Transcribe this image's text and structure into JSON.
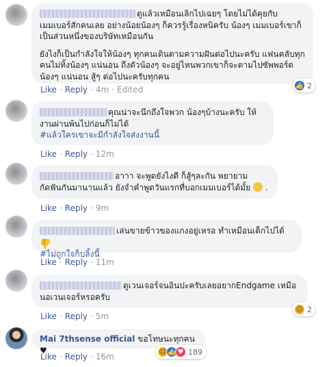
{
  "comments": [
    {
      "text": "ดูแล้วเหมือนเลิกไปเฉยๆ โดยไม่ได้คุยกับเมมเบอร์สักคนเลย อย่างน้อยน้องๆ ก็ควรรู้เรื่องหนิครับ น้องๆ เมมเบอร์เขาก็เป็นส่วนหนึ่งของบริษัทเหมือนกัน",
      "text2": "ยังไงก็เป็นกำลังใจให้น้องๆ ทุกคนเดินตามความฝันต่อไปนะครับ แฟนคลับทุกคนไม่ทิ้งน้องๆ แน่นอน ถึงตัวน้องๆ จะอยู่ไหนพวกเขาก็จะตามไปซัพพอร์ตน้องๆ แน่นอน สู้ๆ ต่อไปนะครับทุกคน",
      "like": "Like",
      "reply": "Reply",
      "time": "4m",
      "edited": "Edited",
      "reaction_count": "2"
    },
    {
      "text": "คุณน่าจะนึกถึงใจพวก น้องๆบ้างนะครับ ให้งานผ่านพ้นไปก่อนก็ไม่ได้",
      "hashtag": "#แล้วใครเขาจะมีกำลังใจส่งงานนี้",
      "like": "Like",
      "reply": "Reply",
      "time": "12m"
    },
    {
      "text": "อาาา จะพูดยังไงดี ก็สู้ๆละกัน พยายามกัดฟันกันมานานแล้ว ยังจำคำพูดวันแรกที่บอกเมมเบอร์ได้มั้ย",
      "text_end": ".",
      "like": "Like",
      "reply": "Reply",
      "time": "9m"
    },
    {
      "text": "เล่นขายข้าวของแกงอยู่เหรอ ทำเหมือนเด็กไปได้",
      "hashtag": "#ไม่ถูกใจก็บลิ้งนี้",
      "like": "Like",
      "reply": "Reply",
      "time": "11m"
    },
    {
      "text": "ดูเวนเจอร์จนอินปะครับเลยอยากEndgame เหมือนอเวนเจอร์หรอครับ",
      "like": "Like",
      "reply": "Reply",
      "time": "5m",
      "reaction_count": "2"
    },
    {
      "name": "Mai 7thsense official",
      "text": "ขอโทษนะทุกคน",
      "like": "Like",
      "reply": "Reply",
      "time": "16m",
      "reaction_count": "189"
    }
  ],
  "separator": "·",
  "colors": {
    "link": "#385898",
    "bubble": "#f2f3f5",
    "meta": "#90949c",
    "like_blue": "#1877f2"
  },
  "icons": [
    "like-icon",
    "love-icon",
    "sad-icon",
    "smile-emoji-icon",
    "thumbs-down-emoji-icon",
    "black-heart-icon"
  ]
}
